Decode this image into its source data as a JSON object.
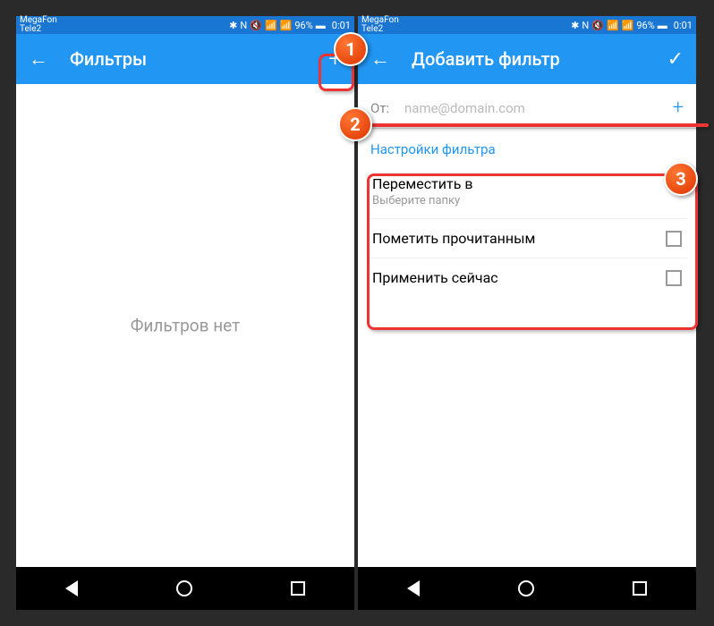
{
  "status": {
    "carrier1": "MegaFon",
    "carrier2": "Tele2",
    "battery": "96%",
    "time": "0:01"
  },
  "left": {
    "title": "Фильтры",
    "empty": "Фильтров нет"
  },
  "right": {
    "title": "Добавить фильтр",
    "from_label": "От:",
    "from_placeholder": "name@domain.com",
    "section": "Настройки фильтра",
    "move_title": "Переместить в",
    "move_sub": "Выберите папку",
    "mark_read": "Пометить прочитанным",
    "apply_now": "Применить сейчас"
  },
  "callouts": {
    "c1": "1",
    "c2": "2",
    "c3": "3"
  }
}
